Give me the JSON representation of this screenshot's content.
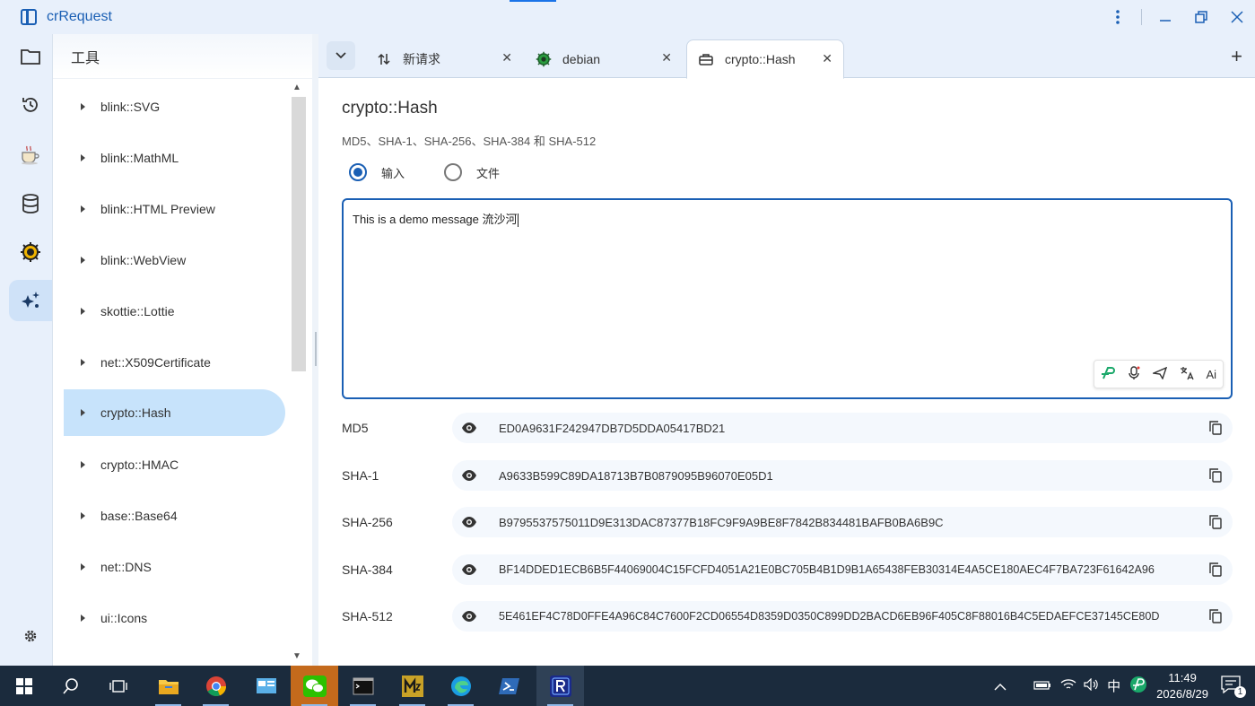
{
  "window": {
    "title": "crRequest"
  },
  "tree": {
    "header": "工具",
    "items": [
      {
        "label": "blink::SVG",
        "active": false
      },
      {
        "label": "blink::MathML",
        "active": false
      },
      {
        "label": "blink::HTML Preview",
        "active": false
      },
      {
        "label": "blink::WebView",
        "active": false
      },
      {
        "label": "skottie::Lottie",
        "active": false
      },
      {
        "label": "net::X509Certificate",
        "active": false
      },
      {
        "label": "crypto::Hash",
        "active": true
      },
      {
        "label": "crypto::HMAC",
        "active": false
      },
      {
        "label": "base::Base64",
        "active": false
      },
      {
        "label": "net::DNS",
        "active": false
      },
      {
        "label": "ui::Icons",
        "active": false
      }
    ]
  },
  "tabs": [
    {
      "label": "新请求",
      "icon": "swap-arrows-icon"
    },
    {
      "label": "debian",
      "icon": "gear-bug-icon"
    },
    {
      "label": "crypto::Hash",
      "icon": "toolbox-icon",
      "active": true
    }
  ],
  "page": {
    "title": "crypto::Hash",
    "subtitle": "MD5、SHA-1、SHA-256、SHA-384 和 SHA-512",
    "radio_input": "输入",
    "radio_file": "文件",
    "input_text": "This is a demo message 流沙河"
  },
  "ime_toolbar": {
    "ai_label": "Ai"
  },
  "hashes": [
    {
      "label": "MD5",
      "value": "ED0A9631F242947DB7D5DDA05417BD21"
    },
    {
      "label": "SHA-1",
      "value": "A9633B599C89DA18713B7B0879095B96070E05D1"
    },
    {
      "label": "SHA-256",
      "value": "B9795537575011D9E313DAC87377B18FC9F9A9BE8F7842B834481BAFB0BA6B9C"
    },
    {
      "label": "SHA-384",
      "value": "BF14DDED1ECB6B5F44069004C15FCFD4051A21E0BC705B4B1D9B1A65438FEB30314E4A5CE180AEC4F7BA723F61642A96"
    },
    {
      "label": "SHA-512",
      "value": "5E461EF4C78D0FFE4A96C84C7600F2CD06554D8359D0350C899DD2BACD6EB96F405C8F88016B4C5EDAEFCE37145CE80D"
    }
  ],
  "taskbar": {
    "ime_lang": "中",
    "time": "11:49",
    "date": "2026/8/29",
    "notification_count": "1"
  },
  "colors": {
    "accent": "#1a5fb4",
    "selection": "#c7e3fb",
    "chrome": "#e8f0fb",
    "taskbar": "#1b2b3d"
  }
}
